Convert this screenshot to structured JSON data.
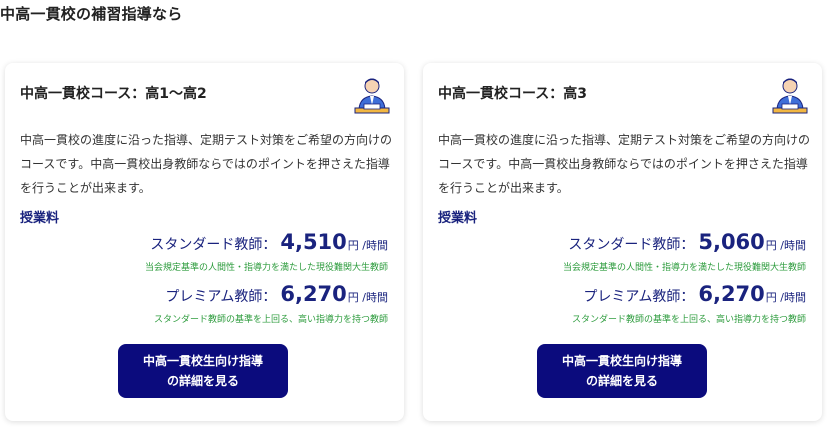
{
  "page": {
    "title": "中高一貫校の補習指導なら"
  },
  "colors": {
    "accent": "#1a237e",
    "button": "#0b0b7d",
    "note": "#2e9c3e"
  },
  "cards": [
    {
      "title": "中高一貫校コース：高1〜高2",
      "icon": "teacher-icon",
      "description": "中高一貫校の進度に沿った指導、定期テスト対策をご希望の方向けのコースです。中高一貫校出身教師ならではのポイントを押さえた指導を行うことが出来ます。",
      "fee_label": "授業料",
      "plans": [
        {
          "name": "スタンダード教師：",
          "price": "4,510",
          "unit": "円 /時間",
          "note": "当会規定基準の人間性・指導力を満たした現役難関大生教師"
        },
        {
          "name": "プレミアム教師：",
          "price": "6,270",
          "unit": "円 /時間",
          "note": "スタンダード教師の基準を上回る、高い指導力を持つ教師"
        }
      ],
      "button": {
        "line1": "中高一貫校生向け指導",
        "line2": "の詳細を見る"
      }
    },
    {
      "title": "中高一貫校コース：高3",
      "icon": "teacher-icon",
      "description": "中高一貫校の進度に沿った指導、定期テスト対策をご希望の方向けのコースです。中高一貫校出身教師ならではのポイントを押さえた指導を行うことが出来ます。",
      "fee_label": "授業料",
      "plans": [
        {
          "name": "スタンダード教師：",
          "price": "5,060",
          "unit": "円 /時間",
          "note": "当会規定基準の人間性・指導力を満たした現役難関大生教師"
        },
        {
          "name": "プレミアム教師：",
          "price": "6,270",
          "unit": "円 /時間",
          "note": "スタンダード教師の基準を上回る、高い指導力を持つ教師"
        }
      ],
      "button": {
        "line1": "中高一貫校生向け指導",
        "line2": "の詳細を見る"
      }
    }
  ]
}
